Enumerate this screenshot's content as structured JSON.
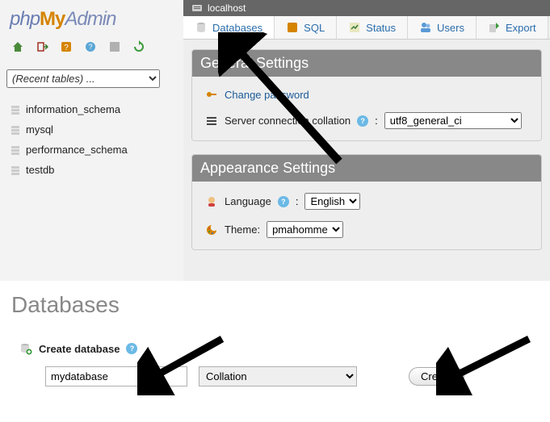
{
  "logo": {
    "php": "php",
    "my": "My",
    "admin": "Admin"
  },
  "breadcrumb": {
    "host": "localhost"
  },
  "tabs": {
    "databases": "Databases",
    "sql": "SQL",
    "status": "Status",
    "users": "Users",
    "export": "Export"
  },
  "sidebar": {
    "recent_placeholder": "(Recent tables) ...",
    "dbs": [
      "information_schema",
      "mysql",
      "performance_schema",
      "testdb"
    ]
  },
  "general": {
    "title": "General Settings",
    "change_password": "Change password",
    "collation_label": "Server connection collation",
    "collation_value": "utf8_general_ci"
  },
  "appearance": {
    "title": "Appearance Settings",
    "language_label": "Language",
    "language_value": "English",
    "theme_label": "Theme:",
    "theme_value": "pmahomme"
  },
  "databases_page": {
    "title": "Databases",
    "create_label": "Create database",
    "dbname_value": "mydatabase",
    "collation_placeholder": "Collation",
    "create_btn": "Create"
  }
}
